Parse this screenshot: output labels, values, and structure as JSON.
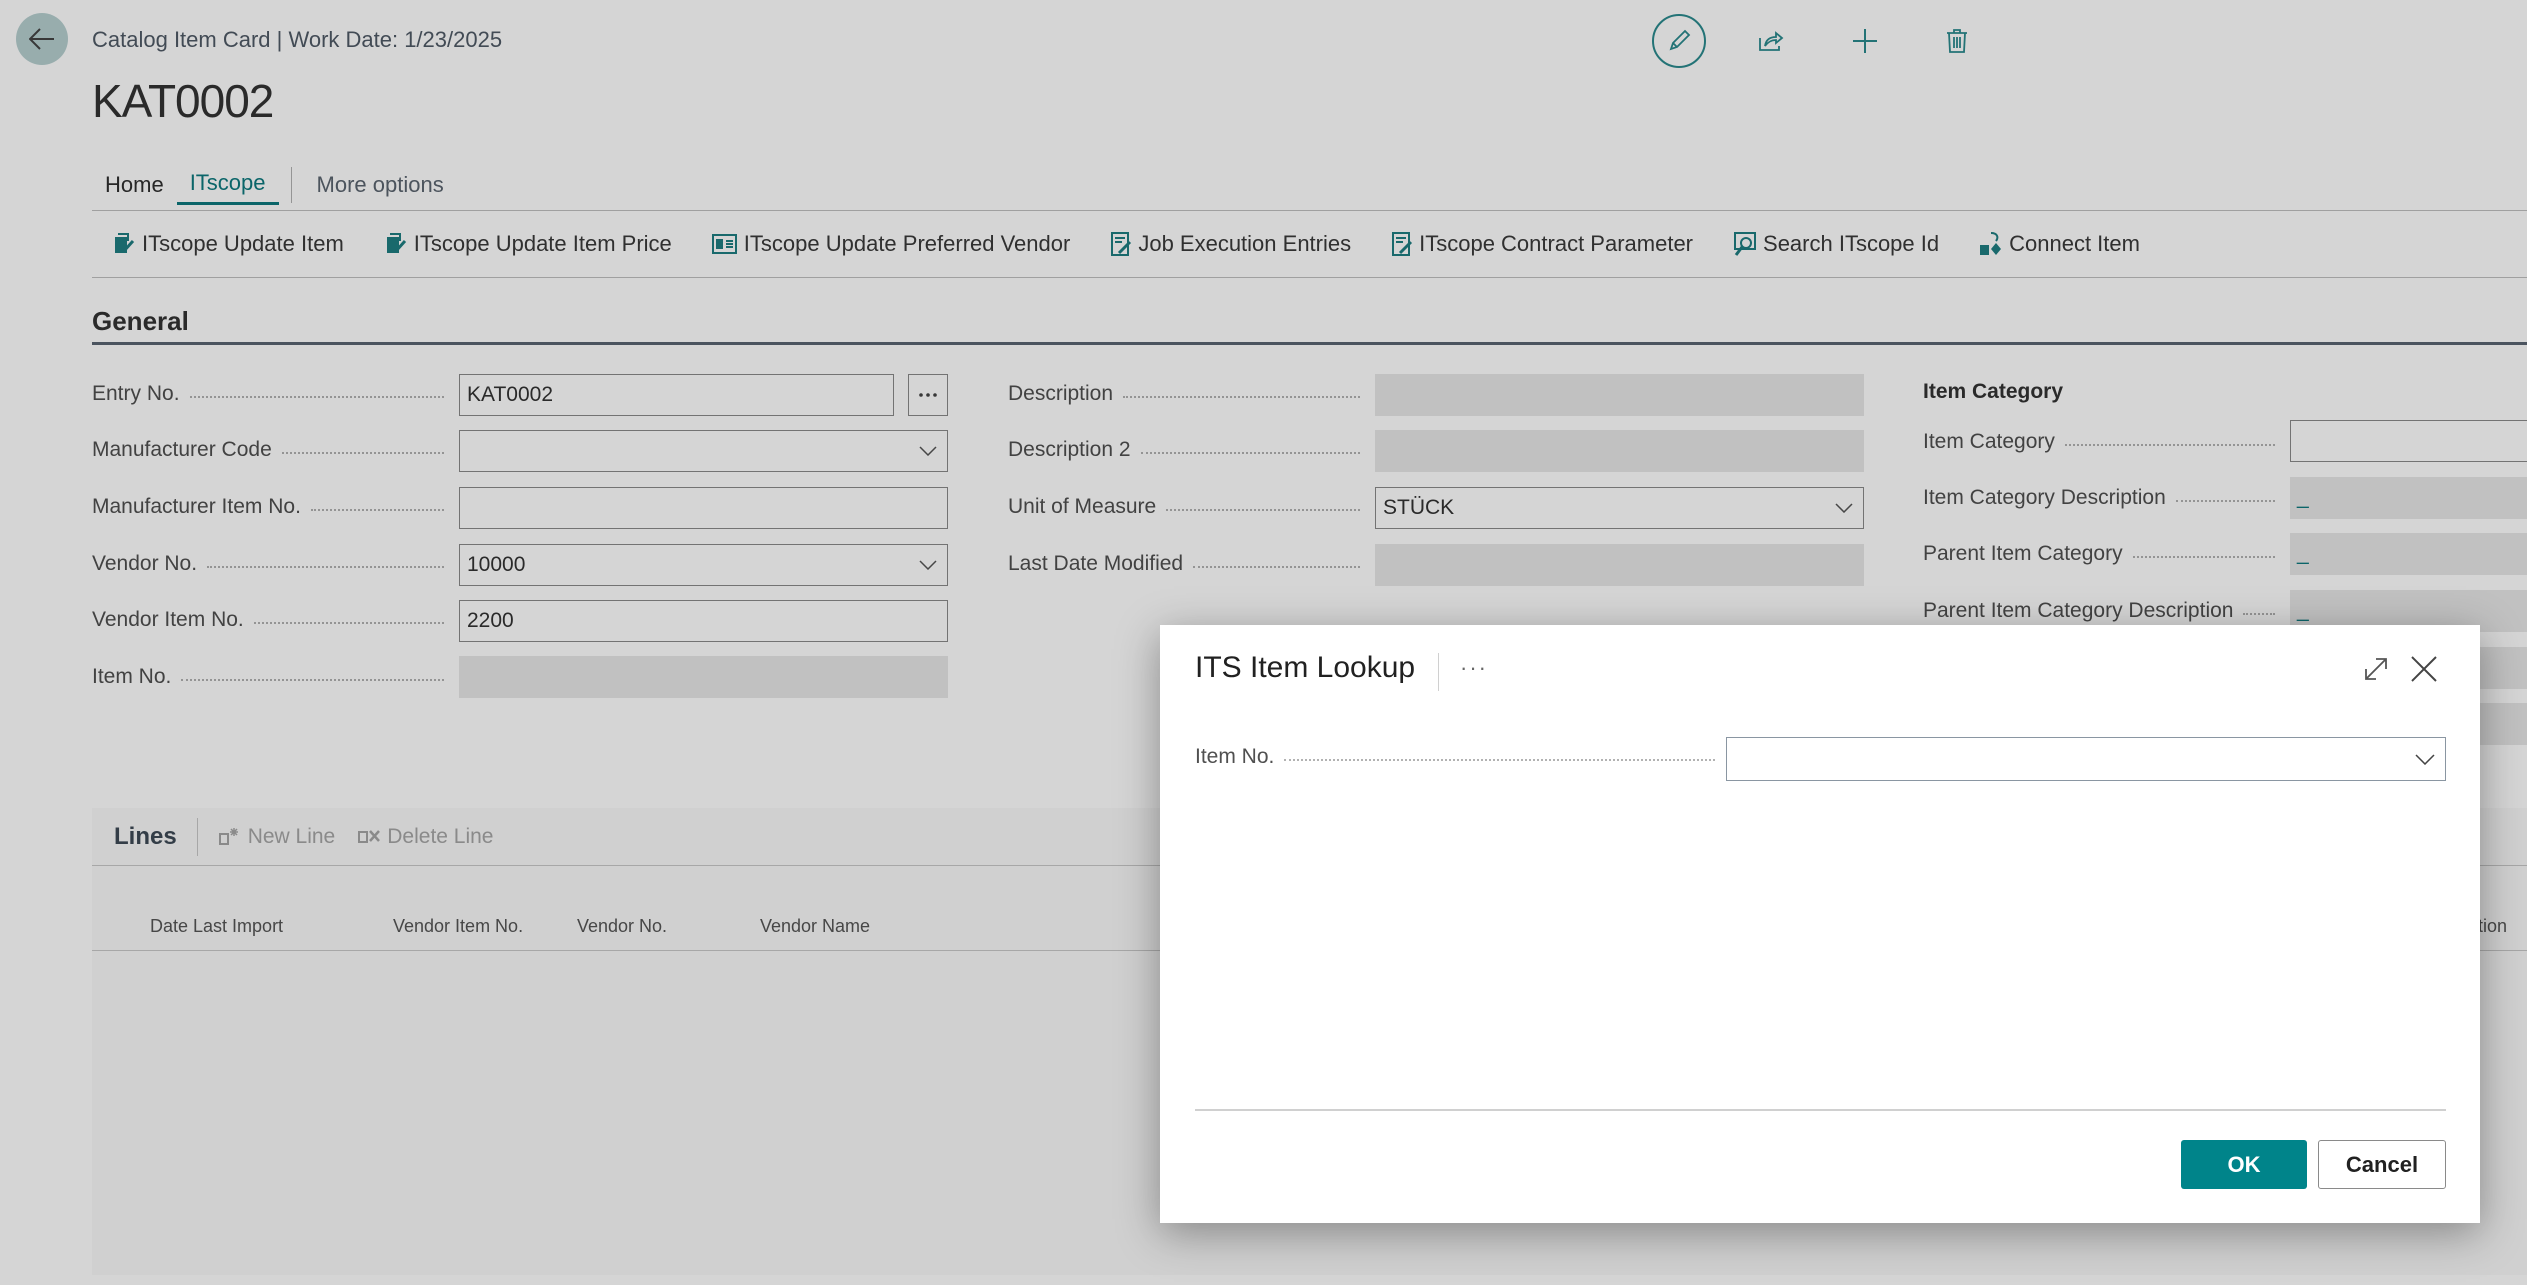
{
  "header": {
    "caption": "Catalog Item Card | Work Date: 1/23/2025",
    "record_title": "KAT0002",
    "icons": [
      "back-arrow-icon",
      "edit-icon",
      "share-icon",
      "add-icon",
      "delete-icon"
    ]
  },
  "tabs": [
    {
      "label": "Home",
      "active": false
    },
    {
      "label": "ITscope",
      "active": true
    },
    {
      "label": "More options",
      "active": false
    }
  ],
  "actions": [
    {
      "label": "ITscope Update Item",
      "icon": "update-item-icon"
    },
    {
      "label": "ITscope Update Item Price",
      "icon": "update-price-icon"
    },
    {
      "label": "ITscope Update Preferred Vendor",
      "icon": "vendor-card-icon"
    },
    {
      "label": "Job Execution Entries",
      "icon": "edit-document-icon"
    },
    {
      "label": "ITscope Contract Parameter",
      "icon": "edit-document-icon"
    },
    {
      "label": "Search ITscope Id",
      "icon": "search-document-icon"
    },
    {
      "label": "Connect Item",
      "icon": "connect-icon"
    }
  ],
  "general": {
    "title": "General",
    "col1": [
      {
        "label": "Entry No.",
        "value": "KAT0002",
        "type": "text-with-lookup"
      },
      {
        "label": "Manufacturer Code",
        "value": "",
        "type": "dropdown"
      },
      {
        "label": "Manufacturer Item No.",
        "value": "",
        "type": "text"
      },
      {
        "label": "Vendor No.",
        "value": "10000",
        "type": "dropdown"
      },
      {
        "label": "Vendor Item No.",
        "value": "2200",
        "type": "text"
      },
      {
        "label": "Item No.",
        "value": "",
        "type": "readonly"
      }
    ],
    "col2": [
      {
        "label": "Description",
        "value": "",
        "type": "readonly"
      },
      {
        "label": "Description 2",
        "value": "",
        "type": "readonly"
      },
      {
        "label": "Unit of Measure",
        "value": "STÜCK",
        "type": "dropdown"
      },
      {
        "label": "Last Date Modified",
        "value": "",
        "type": "readonly"
      }
    ],
    "item_category": {
      "title": "Item Category",
      "fields": [
        {
          "label": "Item Category",
          "value": "",
          "type": "text"
        },
        {
          "label": "Item Category Description",
          "value": "_",
          "type": "readonly"
        },
        {
          "label": "Parent Item Category",
          "value": "_",
          "type": "readonly"
        },
        {
          "label": "Parent Item Category Description",
          "value": "_",
          "type": "readonly"
        }
      ]
    }
  },
  "lines": {
    "title": "Lines",
    "actions": [
      {
        "label": "New Line",
        "icon": "new-line-icon",
        "enabled": false
      },
      {
        "label": "Delete Line",
        "icon": "delete-line-icon",
        "enabled": false
      }
    ],
    "columns": [
      "Date Last Import",
      "Vendor Item No.",
      "Vendor No.",
      "Vendor Name"
    ],
    "partial_column": "tion",
    "rows": []
  },
  "dialog": {
    "title": "ITS Item Lookup",
    "more_label": "···",
    "field_label": "Item No.",
    "field_value": "",
    "ok_label": "OK",
    "cancel_label": "Cancel"
  },
  "colors": {
    "accent": "#00848a",
    "back_button_bg": "#b6cfd0"
  }
}
